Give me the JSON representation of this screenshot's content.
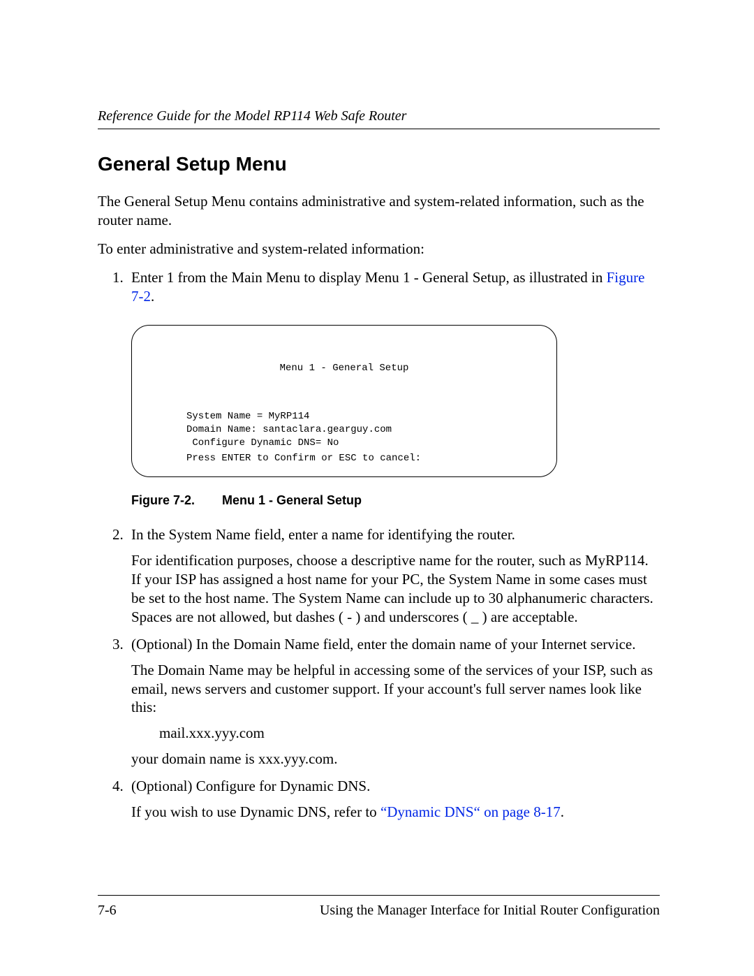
{
  "header": {
    "running_title": "Reference Guide for the Model RP114 Web Safe Router"
  },
  "section": {
    "title": "General Setup Menu",
    "intro1": "The General Setup Menu contains administrative and system-related information, such as the router name.",
    "intro2": "To enter administrative and system-related information:"
  },
  "steps": {
    "s1_prefix": "Enter 1 from the Main Menu to display Menu 1 - General Setup, as illustrated in ",
    "s1_link": "Figure 7-2",
    "s1_suffix": ".",
    "s2_a": "In the System Name field, enter a name for identifying the router.",
    "s2_b": "For identification purposes, choose a descriptive name for the router, such as MyRP114. If your ISP has assigned a host name for your PC, the System Name in some cases must be set to the host name. The System Name can include up to 30 alphanumeric characters. Spaces are not allowed, but dashes ( - ) and underscores ( _ ) are acceptable.",
    "s3_a": "(Optional) In the Domain Name field, enter the domain name of your Internet service.",
    "s3_b": "The Domain Name may be helpful in accessing some of the services of your ISP, such as email, news servers and customer support. If your account's full server names look like this:",
    "s3_example": "mail.xxx.yyy.com",
    "s3_c": "your domain name is xxx.yyy.com.",
    "s4_a": "(Optional) Configure for Dynamic DNS.",
    "s4_b_prefix": "If you wish to use Dynamic DNS, refer to ",
    "s4_b_link": "“Dynamic DNS“ on page 8-17",
    "s4_b_suffix": "."
  },
  "terminal": {
    "title": "Menu 1 - General Setup",
    "line1": "System Name = MyRP114",
    "line2": "Domain Name: santaclara.gearguy.com",
    "line3": " Configure Dynamic DNS= No",
    "footer": "Press ENTER to Confirm or ESC to cancel:"
  },
  "figure": {
    "label": "Figure 7-2.",
    "title": "Menu 1 - General Setup"
  },
  "footer": {
    "page_num": "7-6",
    "chapter": "Using the Manager Interface for Initial Router Configuration"
  }
}
